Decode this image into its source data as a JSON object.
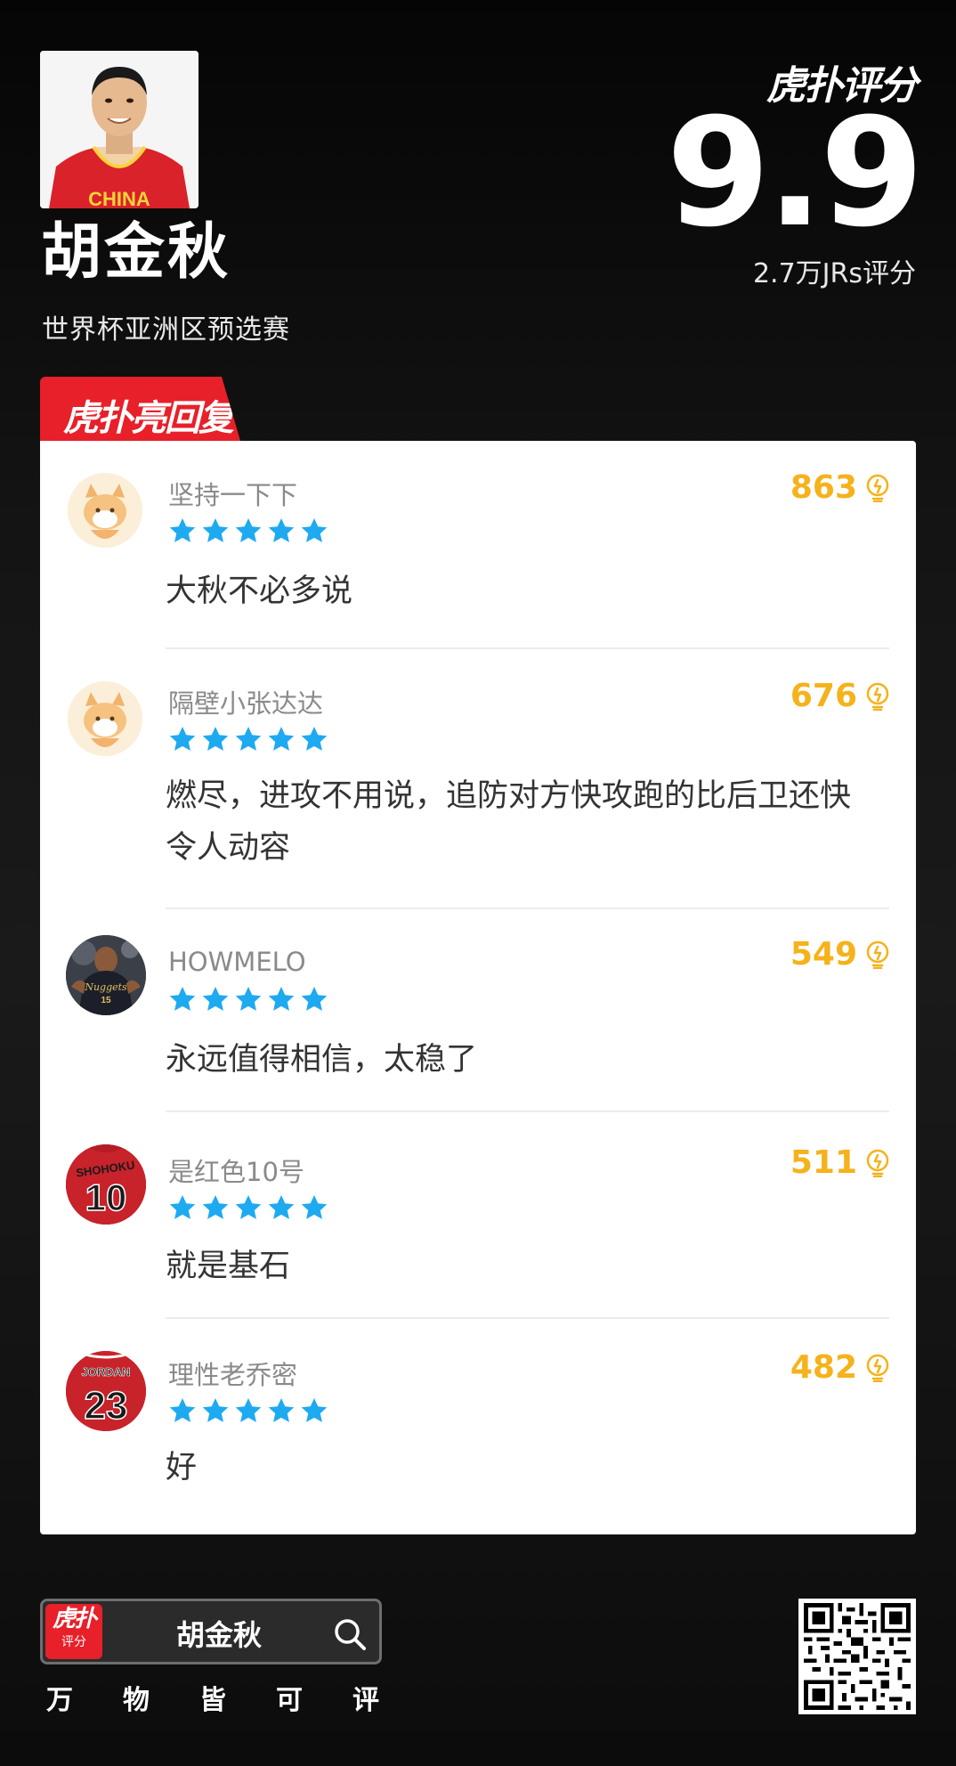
{
  "player": {
    "name": "胡金秋",
    "event": "世界杯亚洲区预选赛",
    "jersey_text": "CHINA"
  },
  "brand": {
    "logo_text": "虎扑评分"
  },
  "score": {
    "value": "9.9",
    "rating_count": "2.7万JRs评分"
  },
  "section": {
    "tag_label": "虎扑亮回复"
  },
  "colors": {
    "accent_red": "#e8202a",
    "likes_yellow": "#f5b21b",
    "star_blue": "#1eaaf0"
  },
  "comments": [
    {
      "username": "坚持一下下",
      "stars": 5,
      "likes": "863",
      "text": "大秋不必多说",
      "avatar": "cartoon-dog-avatar"
    },
    {
      "username": "隔壁小张达达",
      "stars": 5,
      "likes": "676",
      "text": "燃尽，进攻不用说，追防对方快攻跑的比后卫还快令人动容",
      "avatar": "cartoon-dog-avatar"
    },
    {
      "username": "HOWMELO",
      "stars": 5,
      "likes": "549",
      "text": "永远值得相信，太稳了",
      "avatar": "basketball-player-avatar",
      "avatar_jersey": "Nuggets 15"
    },
    {
      "username": "是红色10号",
      "stars": 5,
      "likes": "511",
      "text": "就是基石",
      "avatar": "red-jersey-avatar",
      "avatar_jersey": [
        "SHOHOKU",
        "10"
      ]
    },
    {
      "username": "理性老乔密",
      "stars": 5,
      "likes": "482",
      "text": "好",
      "avatar": "red-jersey-avatar",
      "avatar_jersey": [
        "JORDAN",
        "23"
      ]
    }
  ],
  "footer": {
    "app_icon_top": "虎扑",
    "app_icon_bottom": "评分",
    "search_text": "胡金秋",
    "slogan": [
      "万",
      "物",
      "皆",
      "可",
      "评"
    ]
  }
}
